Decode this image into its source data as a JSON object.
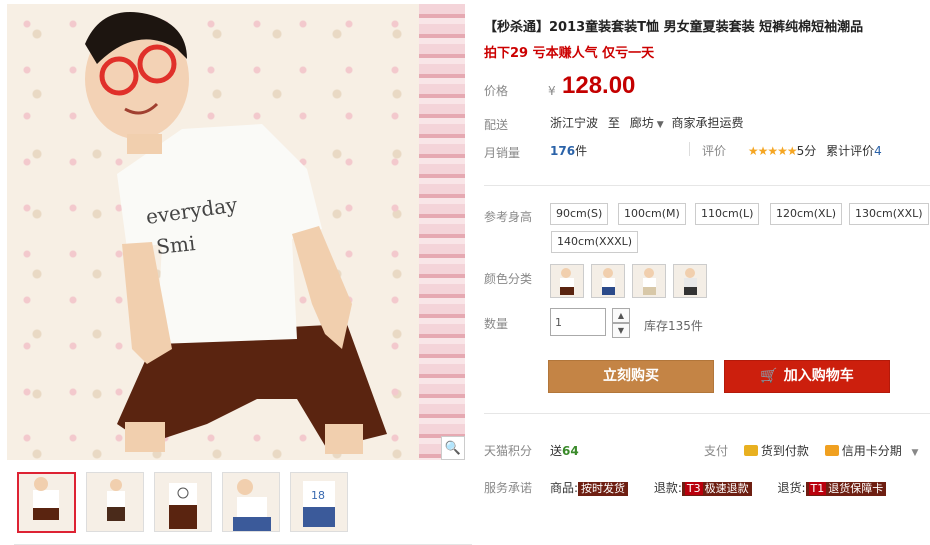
{
  "product": {
    "title": "【秒杀通】2013童装套装T恤 男女童夏装套装 短裤纯棉短袖潮品",
    "promo": "拍下29 亏本赚人气 仅亏一天"
  },
  "price": {
    "label": "价格",
    "currency": "¥",
    "value": "128.00"
  },
  "shipping": {
    "label": "配送",
    "from": "浙江宁波",
    "to_word": "至",
    "to": "廊坊",
    "fee": "商家承担运费"
  },
  "sales": {
    "label": "月销量",
    "count": "176",
    "unit": "件"
  },
  "rating": {
    "label": "评价",
    "stars": "★★★★★",
    "score": "5分",
    "reviews_label": "累计评价",
    "reviews_count": "4"
  },
  "size": {
    "label": "参考身高",
    "options": [
      "90cm(S)",
      "100cm(M)",
      "110cm(L)",
      "120cm(XL)",
      "130cm(XXL)",
      "140cm(XXXL)"
    ]
  },
  "color": {
    "label": "颜色分类",
    "count": 4
  },
  "quantity": {
    "label": "数量",
    "value": "1",
    "stock": "库存135件"
  },
  "actions": {
    "buy": "立刻购买",
    "cart": "加入购物车"
  },
  "points": {
    "label": "天猫积分",
    "prefix": "送",
    "value": "64"
  },
  "payment": {
    "label": "支付",
    "cod": "货到付款",
    "installment": "信用卡分期"
  },
  "service": {
    "label": "服务承诺",
    "goods_label": "商品:",
    "goods_tag": "按时发货",
    "refund_label": "退款:",
    "refund_code": "T3",
    "refund_tag": "极速退款",
    "return_label": "退货:",
    "return_code": "T1",
    "return_tag": "退货保障卡"
  },
  "colors": {
    "accent": "#c40000",
    "buy_button": "#c48445",
    "cart_button": "#cc1f0d"
  }
}
